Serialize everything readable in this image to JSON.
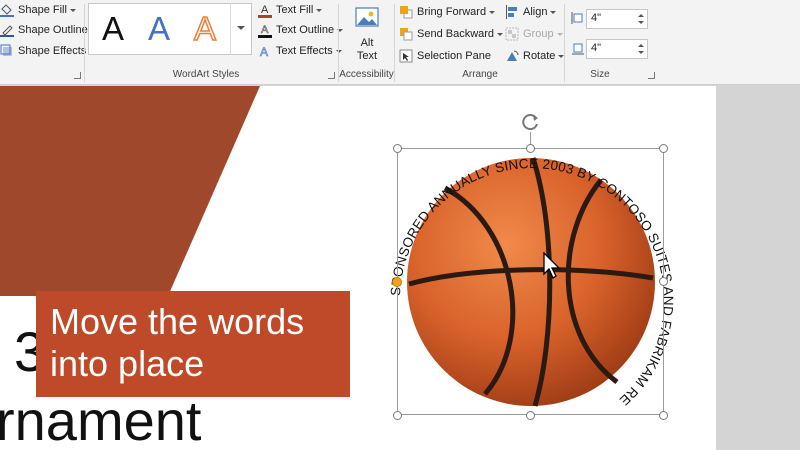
{
  "ribbon": {
    "shape_styles": {
      "fill": "Shape Fill",
      "outline": "Shape Outline",
      "effects": "Shape Effects"
    },
    "wordart": {
      "label": "WordArt Styles",
      "styles": [
        {
          "glyph": "A",
          "name": "Fill: Black, Text color 1"
        },
        {
          "glyph": "A",
          "name": "Fill: Blue, Accent 1"
        },
        {
          "glyph": "A",
          "name": "Outline: Orange, Accent 2"
        }
      ],
      "text_fill": "Text Fill",
      "text_outline": "Text Outline",
      "text_effects": "Text Effects"
    },
    "accessibility": {
      "label": "Accessibility",
      "alt_text_line1": "Alt",
      "alt_text_line2": "Text"
    },
    "arrange": {
      "label": "Arrange",
      "bring_forward": "Bring Forward",
      "send_backward": "Send Backward",
      "selection_pane": "Selection Pane",
      "align": "Align",
      "group": "Group",
      "rotate": "Rotate"
    },
    "size": {
      "label": "Size",
      "height": "4\"",
      "width": "4\""
    }
  },
  "slide": {
    "title_fragment": "3",
    "subtitle_fragment": "rnament",
    "callout_line1": "Move the words",
    "callout_line2": "into place",
    "arc_text": "SPONSORED ANNUALLY SINCE 2003 BY CONTOSO SUITES AND FABRIKAM RESIDENCES"
  },
  "colors": {
    "brown_band": "#a0482b",
    "callout": "#bf4a2a",
    "ball": "#d9622b",
    "wordart_blue": "#4472c4",
    "wordart_orange": "#ed7d31",
    "handle_orange": "#f2a21a"
  },
  "icons": {
    "shape_fill": "paint-bucket-icon",
    "shape_outline": "pen-outline-icon",
    "shape_effects": "shape-effects-icon",
    "text_fill": "text-fill-icon",
    "text_outline": "text-outline-icon",
    "text_effects": "text-effects-icon",
    "alt_text": "alt-text-image-icon",
    "rotate_handle": "rotate-handle-icon"
  }
}
